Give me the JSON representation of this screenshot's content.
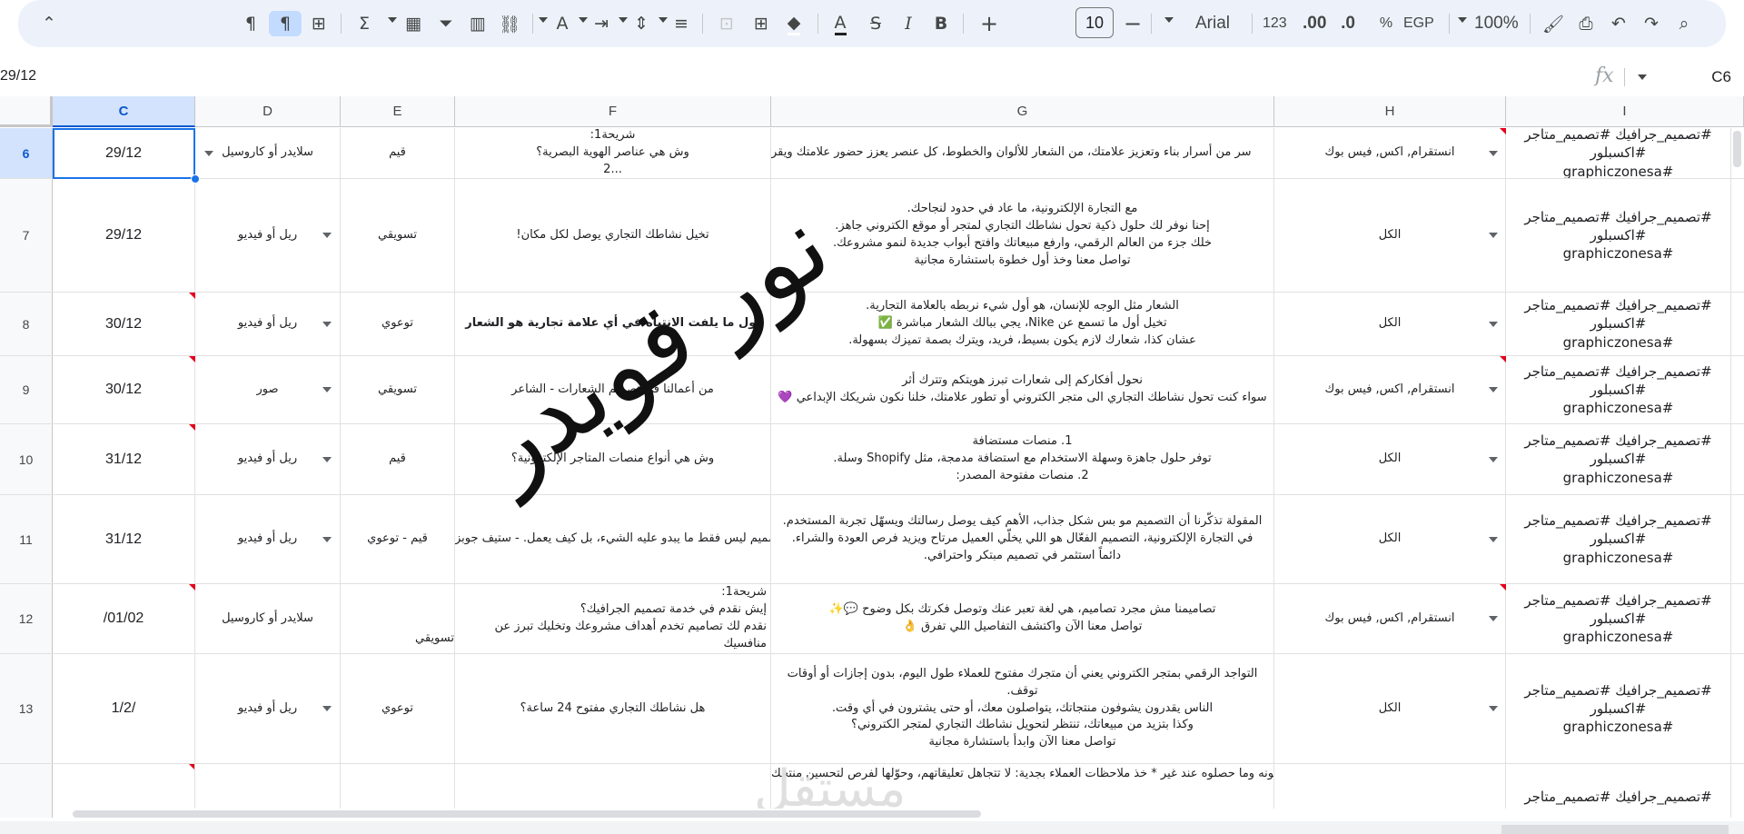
{
  "toolbar": {
    "collapse_icon": "chevron-up-icon",
    "buttons": [
      {
        "name": "rtl-paragraph-icon",
        "glyph": "¶"
      },
      {
        "name": "ltr-paragraph-icon",
        "glyph": "¶"
      },
      {
        "name": "table-icon",
        "glyph": "⊞"
      },
      {
        "name": "functions-icon",
        "glyph": "Σ"
      },
      {
        "name": "calculator-icon",
        "glyph": "▦"
      },
      {
        "name": "filter-icon",
        "glyph": "⏷"
      },
      {
        "name": "chart-icon",
        "glyph": "▥"
      },
      {
        "name": "link-icon",
        "glyph": "⛓"
      },
      {
        "name": "text-rotation-icon",
        "glyph": "A"
      },
      {
        "name": "text-wrap-icon",
        "glyph": "⇥"
      },
      {
        "name": "vertical-align-icon",
        "glyph": "⇕"
      },
      {
        "name": "horizontal-align-icon",
        "glyph": "≡"
      },
      {
        "name": "merge-cells-icon",
        "glyph": "⊡"
      },
      {
        "name": "borders-icon",
        "glyph": "⊞"
      },
      {
        "name": "fill-color-icon",
        "glyph": "◆"
      },
      {
        "name": "text-color-icon",
        "glyph": "A"
      },
      {
        "name": "strikethrough-icon",
        "glyph": "S"
      },
      {
        "name": "italic-icon",
        "glyph": "I"
      },
      {
        "name": "bold-icon",
        "glyph": "B"
      },
      {
        "name": "increase-font-icon",
        "glyph": "+"
      },
      {
        "name": "decrease-font-icon",
        "glyph": "−"
      },
      {
        "name": "paint-format-icon",
        "glyph": "⌨"
      },
      {
        "name": "print-icon",
        "glyph": "⎙"
      },
      {
        "name": "undo-icon",
        "glyph": "↶"
      },
      {
        "name": "redo-icon",
        "glyph": "↷"
      },
      {
        "name": "search-icon",
        "glyph": "⌕"
      }
    ],
    "font_size": "10",
    "font_name": "Arial",
    "format_123": "123",
    "decimal_increase": ".00",
    "decimal_decrease": ".0",
    "percent": "%",
    "currency": "EGP",
    "zoom": "100%"
  },
  "formula_bar": {
    "content": "29/12",
    "fx_label": "fx",
    "name_box": "C6"
  },
  "columns": [
    "C",
    "D",
    "E",
    "F",
    "G",
    "H",
    "I"
  ],
  "selected_column": "C",
  "rows": [
    {
      "num": "6",
      "selected": true,
      "C": "29/12",
      "D": "سلايدر أو كاروسيل",
      "E": "قيم",
      "F": "شريحة1:\nوش هي عناصر الهوية البصرية؟\n...2",
      "G": "سر من أسرار بناء وتعزيز علامتك، من الشعار للألوان والخطوط، كل عنصر يعزز حضور علامتك ويقر",
      "H": "انستقرام, اكس, فيس بوك",
      "I": "#تصميم_جرافيك #تصميم_متاجر #اكسبلور\n#graphiczonesa"
    },
    {
      "num": "7",
      "C": "29/12",
      "D": "ريل أو فيديو",
      "E": "تسويقي",
      "F": "تخيل نشاطك التجاري يوصل لكل مكان!",
      "G": "مع التجارة الإلكترونية، ما عاد في حدود لنجاحك.\nإحنا نوفر لك حلول ذكية تحول نشاطك التجاري لمتجر أو موقع الكتروني جاهز.\nخلك جزء من العالم الرقمي، وارفع مبيعاتك وافتح أبواب جديدة لنمو مشروعك.\nتواصل معنا وخذ أول خطوة باستشارة مجانية",
      "H": "الكل",
      "I": "#تصميم_جرافيك #تصميم_متاجر #اكسبلور\n#graphiczonesa"
    },
    {
      "num": "8",
      "C": "30/12",
      "D": "ريل أو فيديو",
      "E": "توعوي",
      "F": "أول ما يلفت الانتباه في أي علامة تجارية هو الشعار",
      "G": "الشعار مثل الوجه للإنسان، هو أول شيء نربطه بالعلامة التجارية.\nتخيل أول ما تسمع عن Nike، يجي ببالك الشعار مباشرة ✅\nعشان كذا، شعارك لازم يكون بسيط، فريد، ويترك بصمة تميزك بسهولة.",
      "H": "الكل",
      "I": "#تصميم_جرافيك #تصميم_متاجر #اكسبلور\n#graphiczonesa"
    },
    {
      "num": "9",
      "C": "30/12",
      "D": "صور",
      "E": "تسويقي",
      "F": "من أعمالنا في تصميم الشعارات - الشاعر",
      "G": "نحول أفكاركم إلى شعارات تبرز هويتكم وتترك أثر\nسواء كنت تحول نشاطك التجاري الى متجر الكتروني أو تطور علامتك، خلنا نكون شريكك الإبداعي 💜",
      "H": "انستقرام, اكس, فيس بوك",
      "I": "#تصميم_جرافيك #تصميم_متاجر #اكسبلور\n#graphiczonesa"
    },
    {
      "num": "10",
      "C": "31/12",
      "D": "ريل أو فيديو",
      "E": "قيم",
      "F": "وش هي أنواع منصات المتاجر الإلكترونية؟",
      "G": "1.      منصات مستضافة\nتوفر حلول جاهزة وسهلة الاستخدام مع استضافة مدمجة، مثل Shopify وسلة.\n2.      منصات مفتوحة المصدر:",
      "H": "الكل",
      "I": "#تصميم_جرافيك #تصميم_متاجر #اكسبلور\n#graphiczonesa"
    },
    {
      "num": "11",
      "C": "31/12",
      "D": "ريل أو فيديو",
      "E": "قيم - توعوي",
      "F": "التصميم ليس فقط ما يبدو عليه الشيء، بل كيف يعمل. - ستيف جوبز",
      "G": "المقولة تذكّرنا أن التصميم مو بس شكل جذاب، الأهم كيف يوصل رسالتك ويسهّل تجربة المستخدم.\nفي التجارة الإلكترونية، التصميم الفعّال هو اللي يخلّي العميل مرتاح ويزيد فرص العودة والشراء.\nدائماً استثمر في تصميم مبتكر واحترافي.",
      "H": "الكل",
      "I": "#تصميم_جرافيك #تصميم_متاجر #اكسبلور\n#graphiczonesa"
    },
    {
      "num": "12",
      "C": "/01/02",
      "D": "سلايدر أو كاروسيل",
      "E": "",
      "F": "شريحة1:\nإيش نقدم في خدمة تصميم الجرافيك؟\nنقدم لك تصاميم تخدم أهداف مشروعك وتخليك تبرز عن منافسيك",
      "E_overflow": "تسويقي",
      "G": "تصاميمنا مش مجرد تصاميم، هي لغة تعبر عنك وتوصل فكرتك بكل وضوح 💬✨\nتواصل معنا الآن واكتشف التفاصيل اللي تفرق 👌",
      "H": "انستقرام, اكس, فيس بوك",
      "I": "#تصميم_جرافيك #تصميم_متاجر #اكسبلور\n#graphiczonesa"
    },
    {
      "num": "13",
      "C": "1/2/",
      "D": "ريل أو فيديو",
      "E": "توعوي",
      "F": "هل نشاطك التجاري مفتوح 24 ساعة؟",
      "G": "التواجد الرقمي بمتجر الكتروني يعني أن متجرك مفتوح للعملاء طول اليوم، بدون إجازات أو أوقات توقف.\nالناس يقدرون يشوفون منتجاتك، يتواصلون معك، أو حتى يشترون في أي وقت.\nوكذا بتزيد من مبيعاتك، تنتظر لتحويل نشاطك التجاري لمتجر الكتروني؟\nتواصل معنا الآن وابدأ باستشارة مجانية",
      "H": "الكل",
      "I": "#تصميم_جرافيك #تصميم_متاجر #اكسبلور\n#graphiczonesa"
    },
    {
      "num": "",
      "C": "",
      "D": "",
      "E": "",
      "F": "",
      "G": "أل السوق بذكاء: افهم احتياجات العملاء وادرس المنافسين وإسأل: وش اللي يحتاجونه وما حصلوه عند غير\n* خذ ملاحظات العملاء بجدية: لا تتجاهل تعليقاتهم، وحوّلها لفرص لتحسين منتجك",
      "H": "",
      "I": "#تصميم_جرافيك #تصميم_متاجر #اكسبلور"
    }
  ],
  "watermark": "نور قويدر",
  "faint_watermark": "مستقل"
}
